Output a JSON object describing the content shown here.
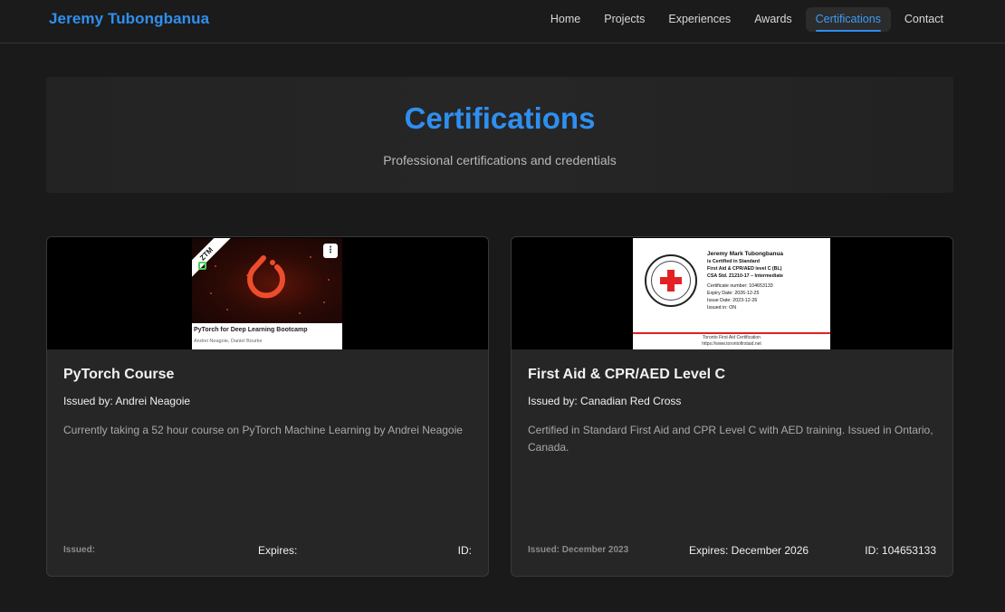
{
  "brand": "Jeremy Tubongbanua",
  "nav": {
    "items": [
      {
        "label": "Home"
      },
      {
        "label": "Projects"
      },
      {
        "label": "Experiences"
      },
      {
        "label": "Awards"
      },
      {
        "label": "Certifications",
        "active": true
      },
      {
        "label": "Contact"
      }
    ]
  },
  "hero": {
    "title": "Certifications",
    "subtitle": "Professional certifications and credentials"
  },
  "colors": {
    "accent": "#2f8ff0",
    "background": "#1a1a1a",
    "card": "#262626"
  },
  "cards": [
    {
      "title": "PyTorch Course",
      "issuer": "Issued by: Andrei Neagoie",
      "description": "Currently taking a 52 hour course on PyTorch Machine Learning by Andrei Neagoie",
      "issued": "Issued:",
      "expires": "Expires:",
      "id": "ID:",
      "thumb": {
        "badge": "ZTM",
        "menu": "⋮",
        "course_name": "PyTorch for Deep Learning Bootcamp",
        "authors": "Andrei Neagoie, Daniel Bourke"
      }
    },
    {
      "title": "First Aid & CPR/AED Level C",
      "issuer": "Issued by: Canadian Red Cross",
      "description": "Certified in Standard First Aid and CPR Level C with AED training. Issued in Ontario, Canada.",
      "issued": "Issued: December 2023",
      "expires": "Expires: December 2026",
      "id": "ID: 104653133",
      "thumb": {
        "name": "Jeremy Mark Tubongbanua",
        "line1": "is Certified in Standard",
        "line2": "First Aid & CPR/AED level C (BL)",
        "line3": "CSA Std. Z1210-17 – Intermediate",
        "cert_no": "Certificate number:  104653133",
        "expiry": "Expiry Date:   2026-12-25",
        "issue": "Issue Date:     2023-12-26",
        "issued_in": "Issued in:   ON",
        "footer1": "Toronto First Aid Certification",
        "footer2": "https://www.torontofirstaid.net"
      }
    }
  ]
}
